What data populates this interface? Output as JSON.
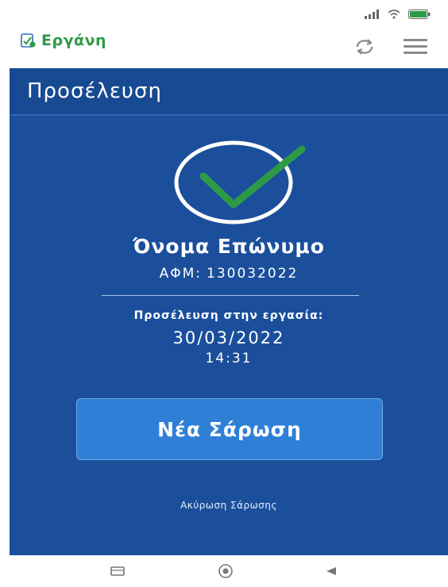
{
  "app": {
    "name": "Εργάνη",
    "brand_color": "#2f9a46",
    "panel_color": "#1b4f9c",
    "button_color": "#2f7fd7"
  },
  "status_bar": {
    "battery_color": "#2f9a46",
    "icons": [
      "signal-icon",
      "wifi-icon",
      "battery-icon"
    ]
  },
  "toolbar": {
    "actions": [
      "sync-icon",
      "menu-icon"
    ]
  },
  "page": {
    "title": "Προσέλευση"
  },
  "result": {
    "status_icon": "check-circle-icon",
    "name": "Όνομα Επώνυμο",
    "afm_label": "ΑΦΜ:",
    "afm_value": "130032022",
    "attendance_label": "Προσέλευση στην εργασία:",
    "date": "30/03/2022",
    "time": "14:31"
  },
  "actions": {
    "new_scan": "Νέα Σάρωση",
    "cancel_scan": "Ακύρωση Σάρωσης"
  },
  "nav_bar": {
    "buttons": [
      "recent-apps-icon",
      "home-icon",
      "back-icon"
    ]
  }
}
